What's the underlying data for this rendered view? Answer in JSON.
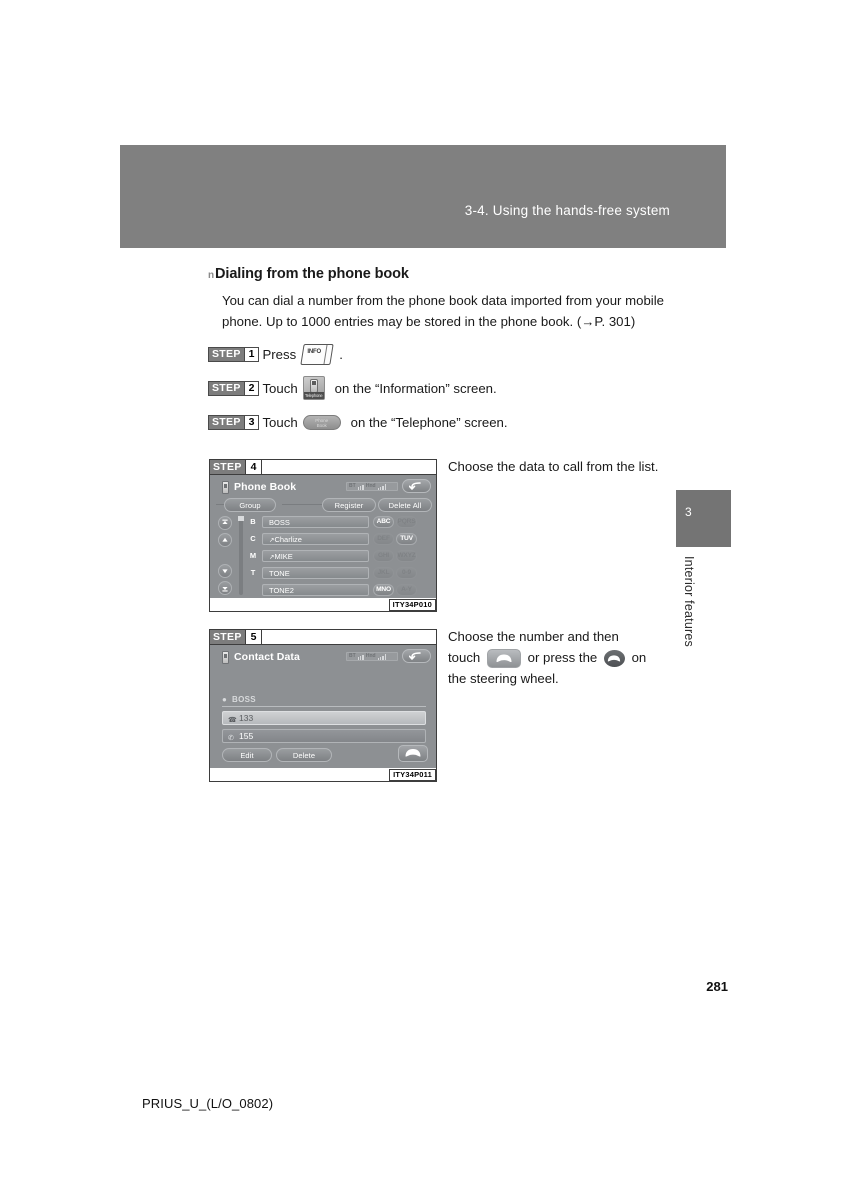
{
  "header": {
    "section_title": "3-4. Using the hands-free system"
  },
  "section": {
    "bullet": "n",
    "heading": "Dialing from the phone book",
    "paragraph": "You can dial a number from the phone book data imported from your mobile phone. Up to 1000 entries may be stored in the phone book. (→P. 301)"
  },
  "steps": [
    {
      "word": "STEP",
      "num": "1",
      "text_before": "Press",
      "icon": "info-hardware-key",
      "icon_label": "INFO",
      "text_after": "."
    },
    {
      "word": "STEP",
      "num": "2",
      "text_before": "Touch",
      "icon": "telephone-tile-icon",
      "icon_label": "Telephone",
      "text_after": "on the “Information” screen."
    },
    {
      "word": "STEP",
      "num": "3",
      "text_before": "Touch",
      "icon": "phone-book-soft-button",
      "icon_label_line1": "Phone",
      "icon_label_line2": "Book",
      "text_after": "on the “Telephone” screen."
    }
  ],
  "figure4": {
    "step_word": "STEP",
    "step_num": "4",
    "code": "ITY34P010",
    "screen": {
      "title": "Phone Book",
      "status_bt": "BT",
      "status_roam": "■■■",
      "status_hfs": "Hnd",
      "back_icon": "back-arrow-icon",
      "buttons": [
        {
          "label": "Group"
        },
        {
          "label": "Register"
        },
        {
          "label": "Delete All"
        }
      ],
      "rows": [
        {
          "letter": "B",
          "prefix": "",
          "name": "BOSS"
        },
        {
          "letter": "C",
          "prefix": "↗",
          "name": "Charlize"
        },
        {
          "letter": "M",
          "prefix": "↗",
          "name": "MIKE"
        },
        {
          "letter": "T",
          "prefix": "",
          "name": "TONE"
        },
        {
          "letter": "",
          "prefix": "",
          "name": "TONE2"
        }
      ],
      "keypad": [
        {
          "label": "ABC",
          "dim": false
        },
        {
          "label": "PQRS",
          "dim": true
        },
        {
          "label": "DEF",
          "dim": true
        },
        {
          "label": "TUV",
          "dim": false
        },
        {
          "label": "GHI",
          "dim": true
        },
        {
          "label": "WXYZ",
          "dim": true
        },
        {
          "label": "JKL",
          "dim": true
        },
        {
          "label": "0-9",
          "dim": true
        },
        {
          "label": "MNO",
          "dim": false
        },
        {
          "label": "A-Y",
          "dim": true
        }
      ]
    }
  },
  "figure5": {
    "step_word": "STEP",
    "step_num": "5",
    "code": "ITY34P011",
    "screen": {
      "title": "Contact Data",
      "status_bt": "BT",
      "status_roam": "■■■",
      "status_hfs": "Hnd",
      "back_icon": "back-arrow-icon",
      "contact_name": "BOSS",
      "numbers": [
        {
          "icon": "home-phone-icon",
          "value": "133"
        },
        {
          "icon": "mobile-phone-icon",
          "value": "155"
        }
      ],
      "buttons": [
        {
          "label": "Edit"
        },
        {
          "label": "Delete"
        }
      ],
      "call_button_icon": "call-handset-icon"
    }
  },
  "notes": {
    "note4": "Choose the data to call from the list.",
    "note5_part1": "Choose the number and then",
    "note5_touch": "touch",
    "note5_part2": "or press the",
    "note5_part3": "on",
    "note5_part4": "the steering wheel."
  },
  "side_tab": {
    "chapter_number": "3",
    "chapter_label": "Interior features"
  },
  "footer": {
    "page_number": "281",
    "doc_code": "PRIUS_U_(L/O_0802)"
  }
}
